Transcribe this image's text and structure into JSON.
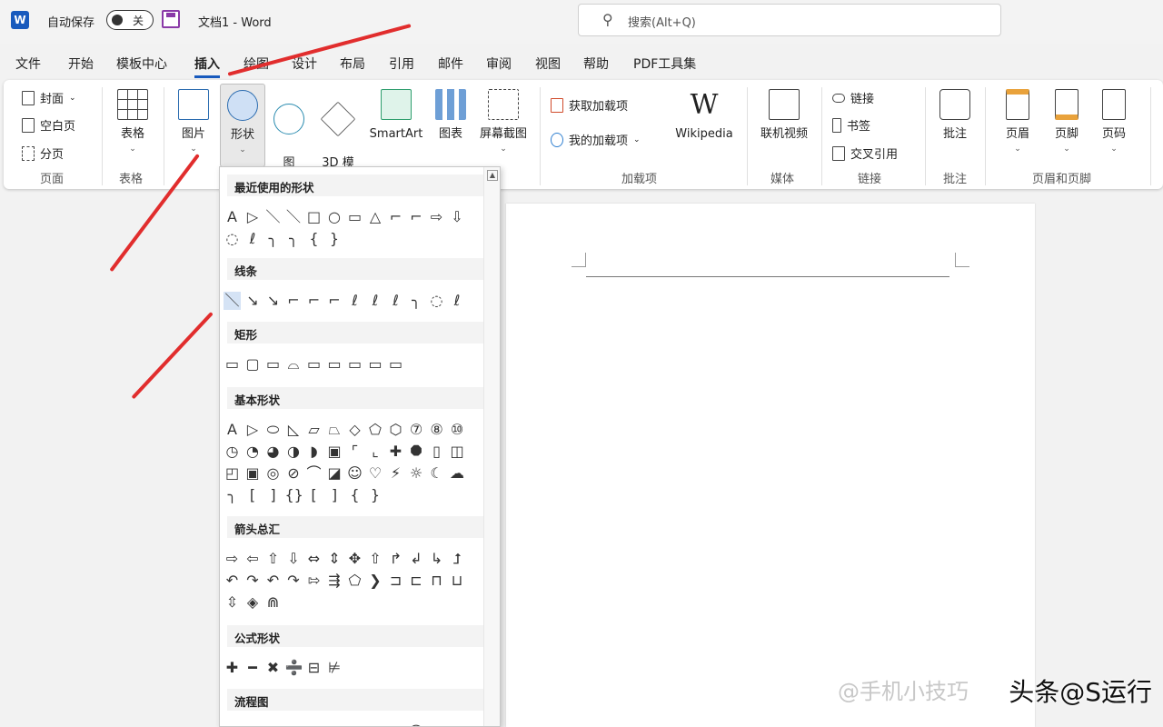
{
  "titlebar": {
    "autosave_label": "自动保存",
    "toggle_state": "关",
    "doc_title": "文档1 - Word",
    "search_placeholder": "搜索(Alt+Q)"
  },
  "tabs": [
    "文件",
    "开始",
    "模板中心",
    "插入",
    "绘图",
    "设计",
    "布局",
    "引用",
    "邮件",
    "审阅",
    "视图",
    "帮助",
    "PDF工具集"
  ],
  "active_tab": "插入",
  "ribbon": {
    "pages": {
      "cover": "封面",
      "blank": "空白页",
      "break": "分页",
      "group": "页面"
    },
    "tables": {
      "table": "表格",
      "group": "表格"
    },
    "illustrations": {
      "pictures": "图片",
      "shapes": "形状",
      "icons": "图\n标",
      "models3d": "3D 模\n型",
      "smartart": "SmartArt",
      "chart": "图表",
      "screenshot": "屏幕截图"
    },
    "addins": {
      "get": "获取加载项",
      "my": "我的加载项",
      "wikipedia": "Wikipedia",
      "group": "加载项"
    },
    "media": {
      "video": "联机视频",
      "group": "媒体"
    },
    "links": {
      "link": "链接",
      "bookmark": "书签",
      "crossref": "交叉引用",
      "group": "链接"
    },
    "comments": {
      "comment": "批注",
      "group": "批注"
    },
    "headerfooter": {
      "header": "页眉",
      "footer": "页脚",
      "pagenum": "页码",
      "group": "页眉和页脚"
    }
  },
  "gallery": {
    "sections": [
      {
        "title": "最近使用的形状",
        "rows": [
          [
            "A",
            "▷",
            "＼",
            "＼",
            "□",
            "○",
            "▭",
            "△",
            "⌐",
            "⌐",
            "⇨",
            "⇩"
          ],
          [
            "◌",
            "ℓ",
            "╮",
            "╮",
            "{",
            "}"
          ]
        ]
      },
      {
        "title": "线条",
        "rows": [
          [
            "＼",
            "↘",
            "↘",
            "⌐",
            "⌐",
            "⌐",
            "ℓ",
            "ℓ",
            "ℓ",
            "╮",
            "◌",
            "ℓ"
          ]
        ]
      },
      {
        "title": "矩形",
        "rows": [
          [
            "▭",
            "▢",
            "▭",
            "⌓",
            "▭",
            "▭",
            "▭",
            "▭",
            "▭"
          ]
        ]
      },
      {
        "title": "基本形状",
        "rows": [
          [
            "A",
            "▷",
            "⬭",
            "◺",
            "▱",
            "⏢",
            "◇",
            "⬠",
            "⬡",
            "⑦",
            "⑧",
            "⑩"
          ],
          [
            "◷",
            "◔",
            "◕",
            "◑",
            "◗",
            "▣",
            "⌜",
            "⌞",
            "✚",
            "⯃",
            "▯",
            "◫"
          ],
          [
            "◰",
            "▣",
            "◎",
            "⊘",
            "⌒",
            "◪",
            "☺",
            "♡",
            "⚡",
            "☼",
            "☾",
            "☁"
          ],
          [
            "╮",
            "[",
            "]",
            "{}",
            "[",
            "]",
            "{",
            "}"
          ]
        ]
      },
      {
        "title": "箭头总汇",
        "rows": [
          [
            "⇨",
            "⇦",
            "⇧",
            "⇩",
            "⇔",
            "⇕",
            "✥",
            "⇧",
            "↱",
            "↲",
            "↳",
            "⮥"
          ],
          [
            "↶",
            "↷",
            "↶",
            "↷",
            "⇰",
            "⇶",
            "⬠",
            "❯",
            "⊐",
            "⊏",
            "⊓",
            "⊔"
          ],
          [
            "⇳",
            "◈",
            "⋒"
          ]
        ]
      },
      {
        "title": "公式形状",
        "rows": [
          [
            "✚",
            "━",
            "✖",
            "➗",
            "⊟",
            "⊭"
          ]
        ]
      },
      {
        "title": "流程图",
        "rows": [
          [
            "□",
            "▭",
            "◇",
            "▱",
            "▭",
            "▭",
            "▭",
            "▭",
            "⬭",
            "◯",
            "▭",
            "▭"
          ]
        ]
      }
    ]
  },
  "watermark": {
    "faint": "@手机小技巧",
    "main": "头条@S运行"
  },
  "colors": {
    "accent": "#185abd",
    "arrow": "#e12d2d"
  }
}
